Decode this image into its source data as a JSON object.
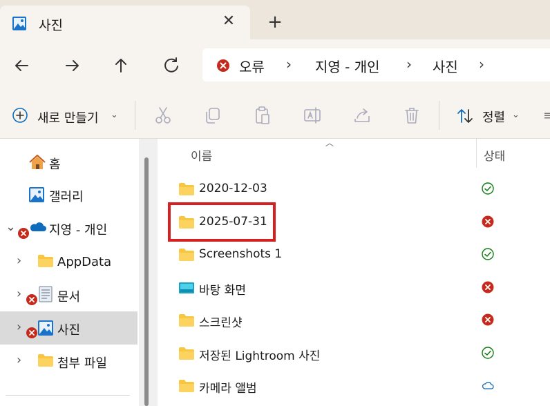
{
  "tab": {
    "title": "사진"
  },
  "address": {
    "crumbs": [
      "오류",
      "지영 - 개인",
      "사진"
    ]
  },
  "toolbar": {
    "new_label": "새로 만들기",
    "sort_label": "정렬"
  },
  "sidebar": {
    "items": [
      {
        "label": "홈"
      },
      {
        "label": "갤러리"
      },
      {
        "label": "지영 - 개인"
      },
      {
        "label": "AppData"
      },
      {
        "label": "문서"
      },
      {
        "label": "사진"
      },
      {
        "label": "첨부 파일"
      }
    ]
  },
  "list": {
    "columns": {
      "name": "이름",
      "status": "상태"
    },
    "rows": [
      {
        "name": "2020-12-03",
        "icon": "folder-icon",
        "status": "synced"
      },
      {
        "name": "2025-07-31",
        "icon": "folder-icon",
        "status": "error"
      },
      {
        "name": "Screenshots 1",
        "icon": "folder-icon",
        "status": "synced"
      },
      {
        "name": "바탕 화면",
        "icon": "desktop-folder-icon",
        "status": "error"
      },
      {
        "name": "스크린샷",
        "icon": "folder-icon",
        "status": "error"
      },
      {
        "name": "저장된 Lightroom 사진",
        "icon": "folder-icon",
        "status": "synced"
      },
      {
        "name": "카메라 앨범",
        "icon": "folder-icon",
        "status": "cloud"
      }
    ]
  },
  "colors": {
    "error": "#c42b1c",
    "synced": "#107c10",
    "cloud": "#0f6cbd",
    "highlight": "#d42020"
  }
}
